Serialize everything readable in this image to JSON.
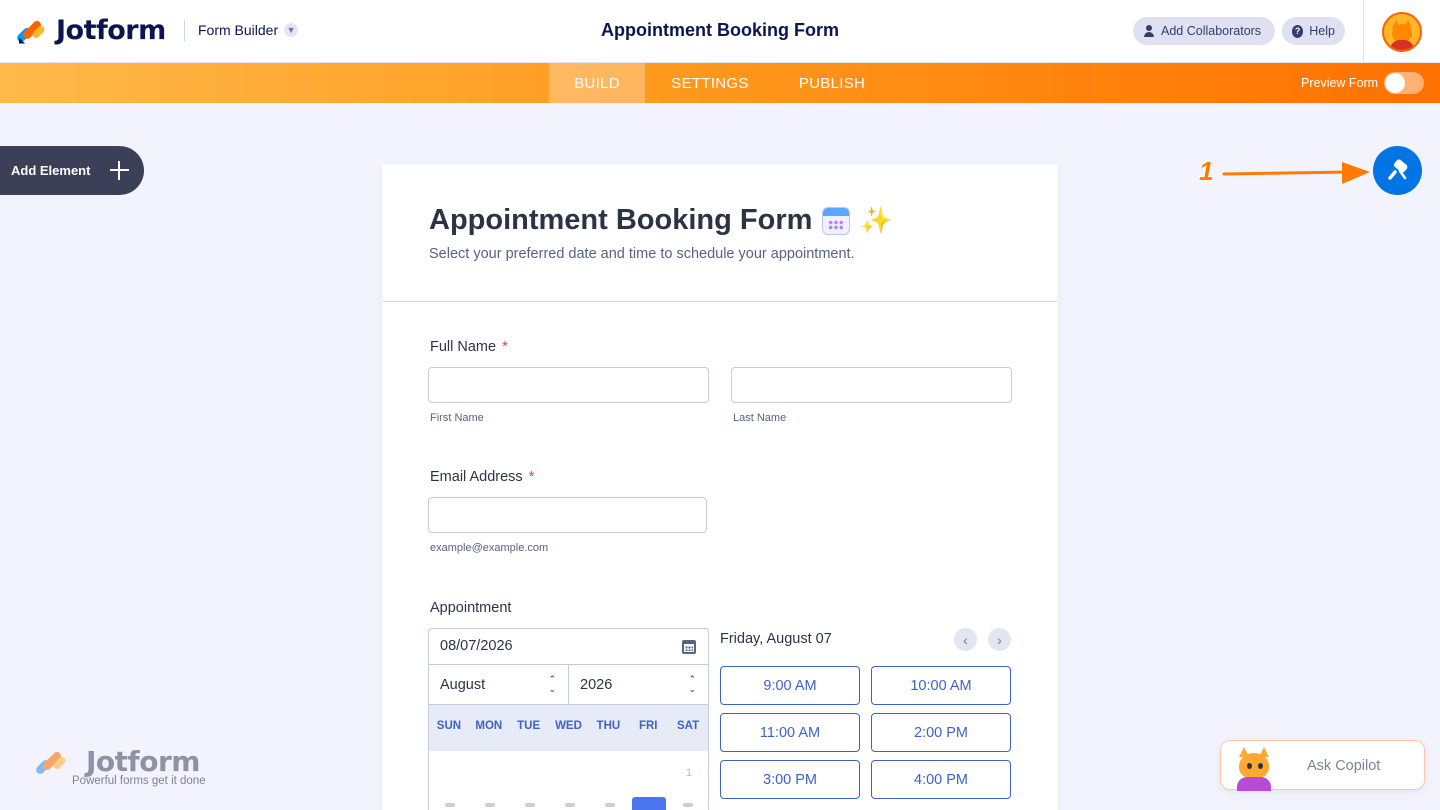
{
  "brand": {
    "name": "Jotform",
    "tagline": "Powerful forms get it done",
    "accent": "#ff6100"
  },
  "header": {
    "builder_menu": "Form Builder",
    "title": "Appointment Booking Form",
    "collaborators_label": "Add Collaborators",
    "help_label": "Help"
  },
  "nav": {
    "tabs": [
      {
        "label": "BUILD",
        "active": true
      },
      {
        "label": "SETTINGS",
        "active": false
      },
      {
        "label": "PUBLISH",
        "active": false
      }
    ],
    "preview_label": "Preview Form",
    "preview_on": false
  },
  "sidebar": {
    "add_element_label": "Add Element"
  },
  "annotation": {
    "number": "1",
    "color": "#ff7a00"
  },
  "form": {
    "title": "Appointment Booking Form",
    "subtitle": "Select your preferred date and time to schedule your appointment.",
    "full_name": {
      "label": "Full Name",
      "required_mark": "*",
      "first_value": "",
      "last_value": "",
      "first_sublabel": "First Name",
      "last_sublabel": "Last Name"
    },
    "email": {
      "label": "Email Address",
      "required_mark": "*",
      "value": "",
      "sublabel": "example@example.com"
    },
    "appointment": {
      "label": "Appointment",
      "date_value": "08/07/2026",
      "month": "August",
      "year": "2026",
      "weekdays": [
        "SUN",
        "MON",
        "TUE",
        "WED",
        "THU",
        "FRI",
        "SAT"
      ],
      "first_day_label": "1",
      "selected_date_label": "Friday, August 07",
      "slots": [
        "9:00 AM",
        "10:00 AM",
        "11:00 AM",
        "2:00 PM",
        "3:00 PM",
        "4:00 PM"
      ]
    }
  },
  "copilot": {
    "label": "Ask Copilot"
  }
}
